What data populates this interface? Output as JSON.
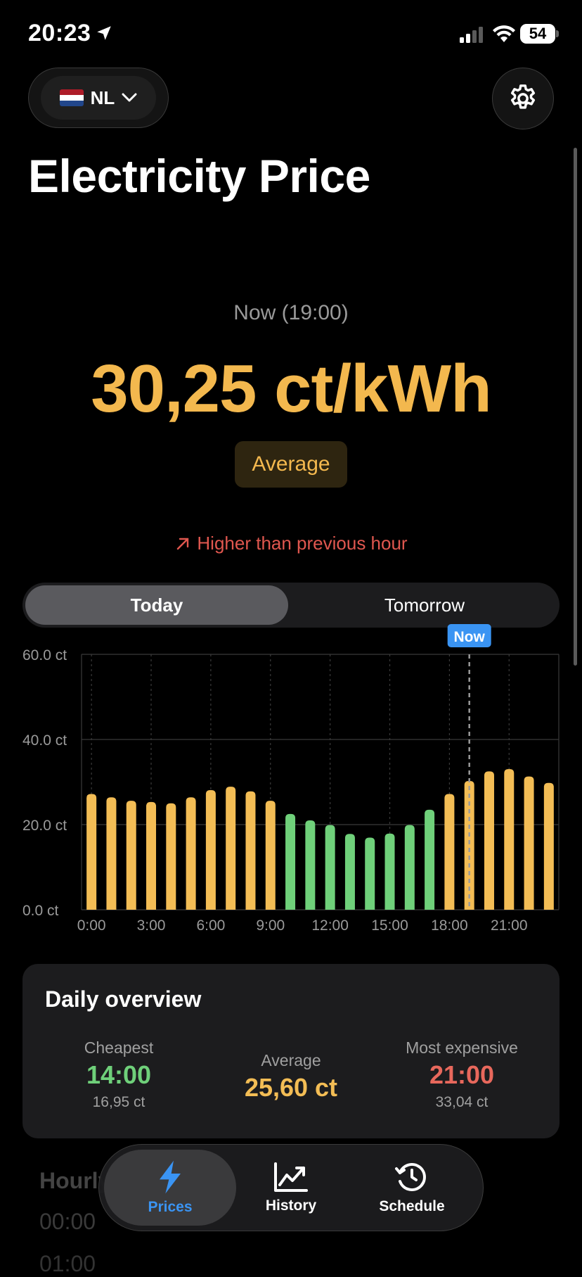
{
  "status_bar": {
    "time": "20:23",
    "battery": "54"
  },
  "header": {
    "country_code": "NL",
    "title": "Electricity Price"
  },
  "current": {
    "label": "Now (19:00)",
    "price": "30,25 ct/kWh",
    "level": "Average",
    "trend": "Higher than previous hour"
  },
  "segments": {
    "today": "Today",
    "tomorrow": "Tomorrow",
    "selected": "Today"
  },
  "chart_data": {
    "type": "bar",
    "x": [
      0,
      1,
      2,
      3,
      4,
      5,
      6,
      7,
      8,
      9,
      10,
      11,
      12,
      13,
      14,
      15,
      16,
      17,
      18,
      19,
      20,
      21,
      22,
      23
    ],
    "values": [
      27.2,
      26.4,
      25.6,
      25.3,
      25.0,
      26.4,
      28.1,
      28.9,
      27.8,
      25.6,
      22.5,
      21.0,
      19.9,
      17.8,
      16.95,
      17.9,
      19.9,
      23.5,
      27.2,
      30.25,
      32.5,
      33.04,
      31.3,
      29.8
    ],
    "colors": {
      "cheap": "#6fd07a",
      "average": "#f3bd55"
    },
    "cheap_hours": [
      10,
      11,
      12,
      13,
      14,
      15,
      16,
      17
    ],
    "ylim": [
      0,
      60
    ],
    "y_ticks": [
      "0.0 ct",
      "20.0 ct",
      "40.0 ct",
      "60.0 ct"
    ],
    "x_ticks": [
      "0:00",
      "3:00",
      "6:00",
      "9:00",
      "12:00",
      "15:00",
      "18:00",
      "21:00"
    ],
    "now_hour": 19,
    "now_label": "Now",
    "grid": true
  },
  "overview": {
    "title": "Daily overview",
    "cheapest": {
      "label": "Cheapest",
      "time": "14:00",
      "price": "16,95 ct",
      "color": "#6fd07a"
    },
    "average": {
      "label": "Average",
      "price": "25,60 ct",
      "color": "#f3bd55"
    },
    "most_expensive": {
      "label": "Most expensive",
      "time": "21:00",
      "price": "33,04 ct",
      "color": "#e8685c"
    }
  },
  "hourly": {
    "title": "Hourly prices",
    "row1_time": "00:00",
    "row2_time": "01:00"
  },
  "tabs": [
    {
      "label": "Prices",
      "icon": "bolt-icon",
      "active": true
    },
    {
      "label": "History",
      "icon": "chart-line-icon",
      "active": false
    },
    {
      "label": "Schedule",
      "icon": "clock-history-icon",
      "active": false
    }
  ],
  "accent": "#3a94f3"
}
